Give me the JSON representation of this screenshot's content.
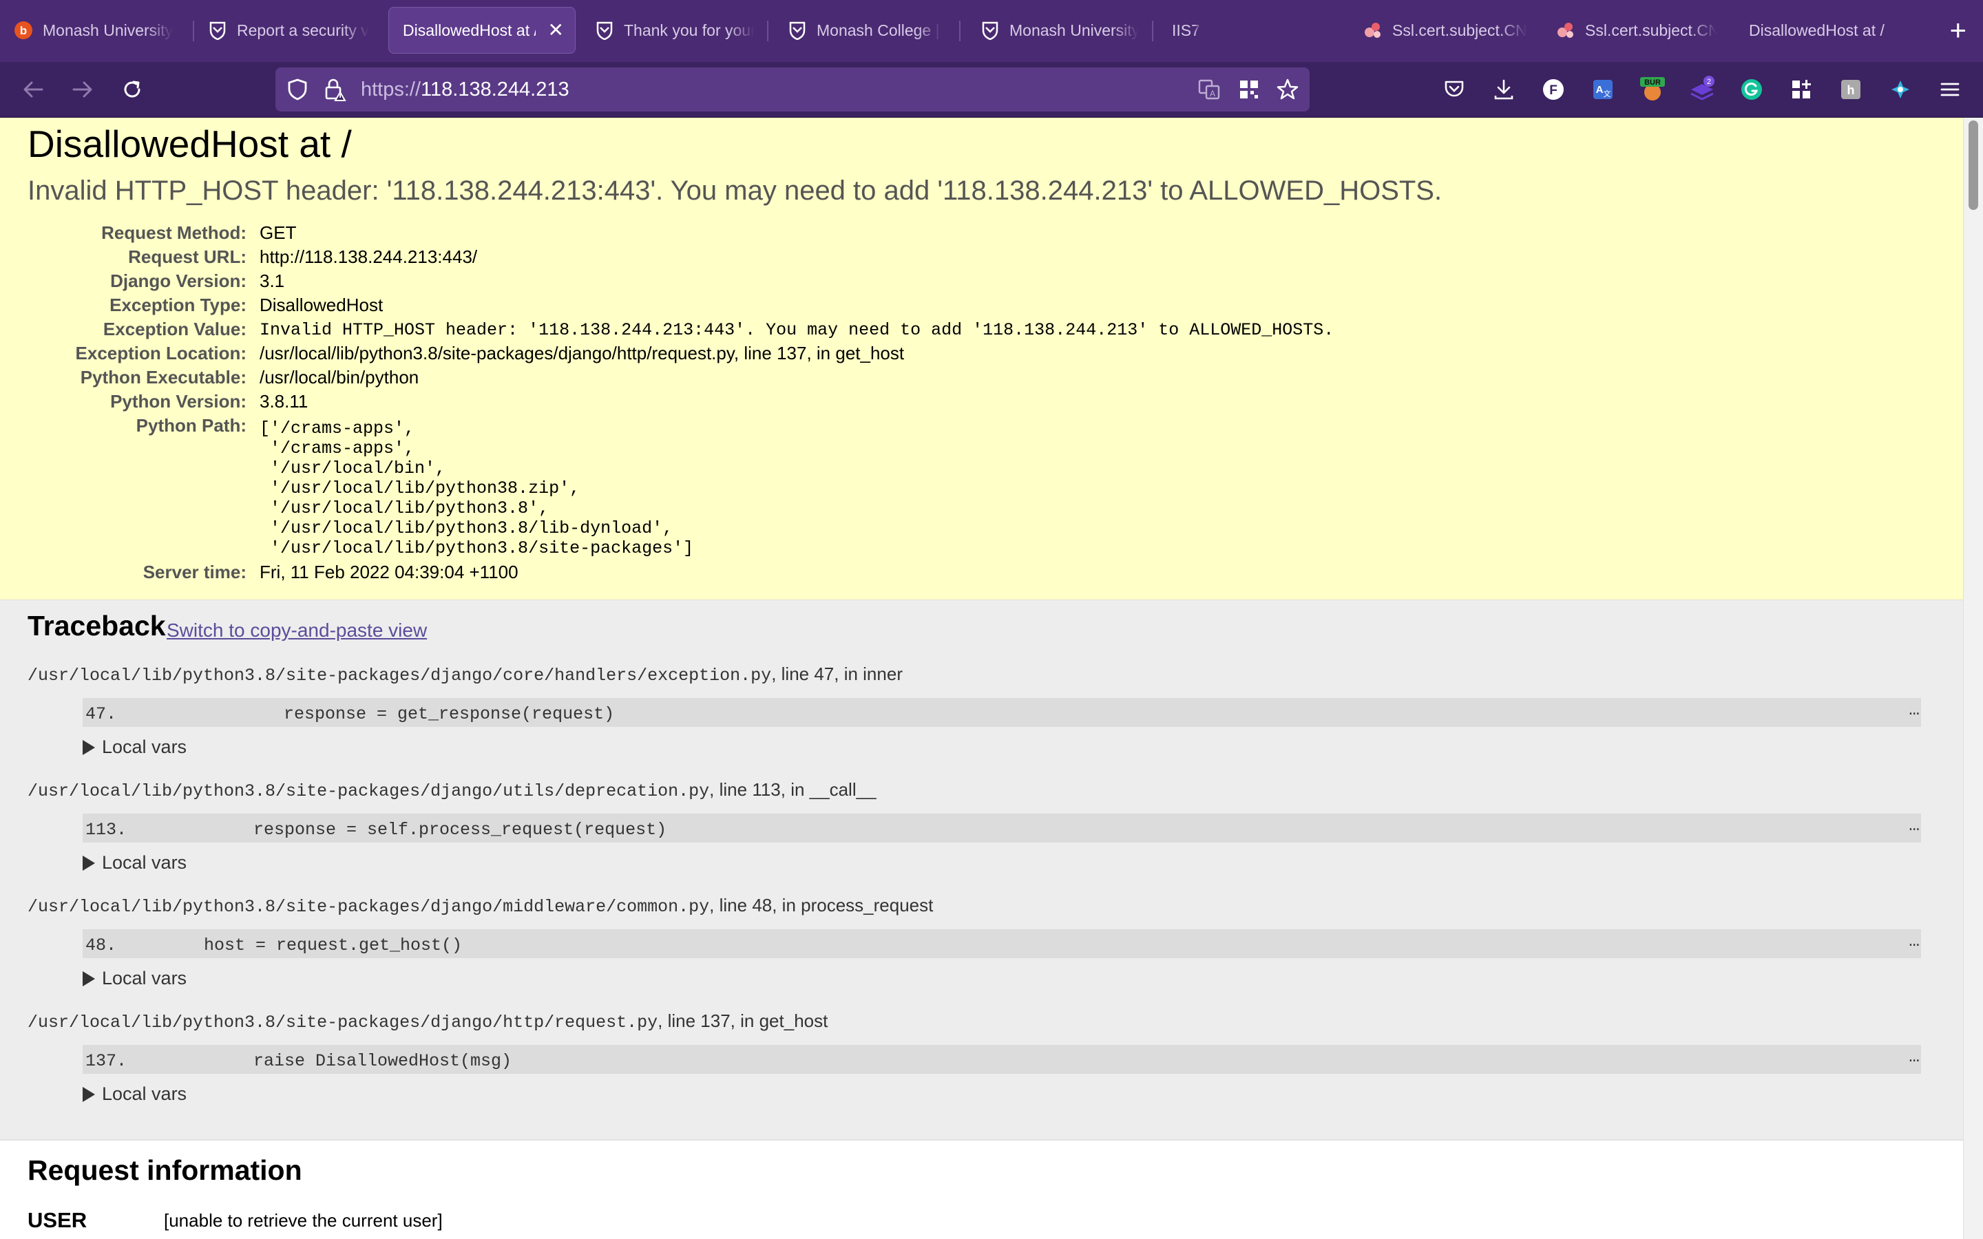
{
  "tabs": [
    {
      "label": "Monash University",
      "icon": "bitdefender-icon",
      "active": false
    },
    {
      "label": "Report a security v",
      "icon": "monash-shield-icon",
      "active": false
    },
    {
      "label": "DisallowedHost at /",
      "icon": "",
      "active": true
    },
    {
      "label": "Thank you for your",
      "icon": "monash-shield-icon",
      "active": false
    },
    {
      "label": "Monash College | M",
      "icon": "monash-shield-icon",
      "active": false
    },
    {
      "label": "Monash University",
      "icon": "monash-shield-icon",
      "active": false
    },
    {
      "label": "IIS7",
      "icon": "",
      "active": false
    },
    {
      "label": "Ssl.cert.subject.CN",
      "icon": "dots-icon",
      "active": false
    },
    {
      "label": "Ssl.cert.subject.CN",
      "icon": "dots-icon",
      "active": false
    },
    {
      "label": "DisallowedHost at /",
      "icon": "",
      "active": false
    }
  ],
  "address": {
    "protocol": "https://",
    "host": "118.138.244.213"
  },
  "toolbar": {
    "extension_badge": "BUR",
    "notification_count": "2"
  },
  "error": {
    "title": "DisallowedHost at /",
    "message": "Invalid HTTP_HOST header: '118.138.244.213:443'. You may need to add '118.138.244.213' to ALLOWED_HOSTS."
  },
  "meta": [
    {
      "key": "Request Method:",
      "value": "GET"
    },
    {
      "key": "Request URL:",
      "value": "http://118.138.244.213:443/"
    },
    {
      "key": "Django Version:",
      "value": "3.1"
    },
    {
      "key": "Exception Type:",
      "value": "DisallowedHost"
    },
    {
      "key": "Exception Value:",
      "value": "Invalid HTTP_HOST header: '118.138.244.213:443'. You may need to add '118.138.244.213' to ALLOWED_HOSTS."
    },
    {
      "key": "Exception Location:",
      "value": "/usr/local/lib/python3.8/site-packages/django/http/request.py, line 137, in get_host"
    },
    {
      "key": "Python Executable:",
      "value": "/usr/local/bin/python"
    },
    {
      "key": "Python Version:",
      "value": "3.8.11"
    },
    {
      "key": "Python Path:",
      "value": ""
    },
    {
      "key": "Server time:",
      "value": "Fri, 11 Feb 2022 04:39:04 +1100"
    }
  ],
  "python_path": "['/crams-apps',\n '/crams-apps',\n '/usr/local/bin',\n '/usr/local/lib/python38.zip',\n '/usr/local/lib/python3.8',\n '/usr/local/lib/python3.8/lib-dynload',\n '/usr/local/lib/python3.8/site-packages']",
  "traceback": {
    "title": "Traceback",
    "switch_link": "Switch to copy-and-paste view",
    "local_vars_label": "Local vars",
    "frames": [
      {
        "path": "/usr/local/lib/python3.8/site-packages/django/core/handlers/exception.py",
        "where": ", line 47, in inner",
        "lineno": "47.",
        "code": "response = get_response(request)"
      },
      {
        "path": "/usr/local/lib/python3.8/site-packages/django/utils/deprecation.py",
        "where": ", line 113, in __call__",
        "lineno": "113.",
        "code": "response = self.process_request(request)"
      },
      {
        "path": "/usr/local/lib/python3.8/site-packages/django/middleware/common.py",
        "where": ", line 48, in process_request",
        "lineno": "48.",
        "code": "host = request.get_host()"
      },
      {
        "path": "/usr/local/lib/python3.8/site-packages/django/http/request.py",
        "where": ", line 137, in get_host",
        "lineno": "137.",
        "code": "raise DisallowedHost(msg)"
      }
    ]
  },
  "request_info": {
    "title": "Request information",
    "user_key": "USER",
    "user_value": "[unable to retrieve the current user]"
  }
}
